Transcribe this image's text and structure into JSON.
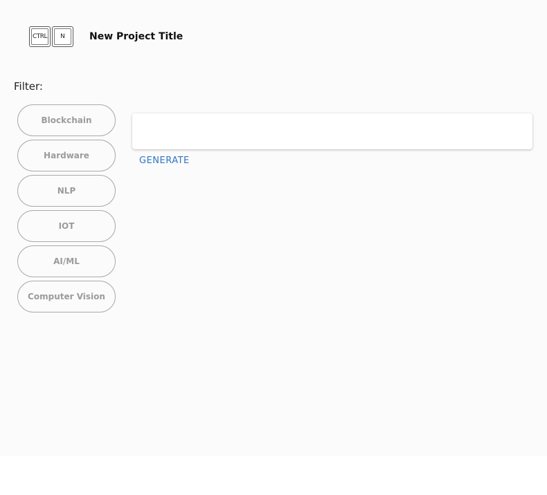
{
  "header": {
    "shortcut_keys": [
      "CTRL",
      "N"
    ],
    "title": "New Project Title"
  },
  "filter": {
    "label": "Filter:",
    "options": [
      "Blockchain",
      "Hardware",
      "NLP",
      "IOT",
      "AI/ML",
      "Computer Vision"
    ]
  },
  "output": {
    "text": ""
  },
  "actions": {
    "generate_label": "GENERATE"
  },
  "colors": {
    "accent": "#2f76c2",
    "chip_text": "#9b9b9b",
    "chip_border": "#aaaaaa",
    "background": "#fbfbfb"
  }
}
